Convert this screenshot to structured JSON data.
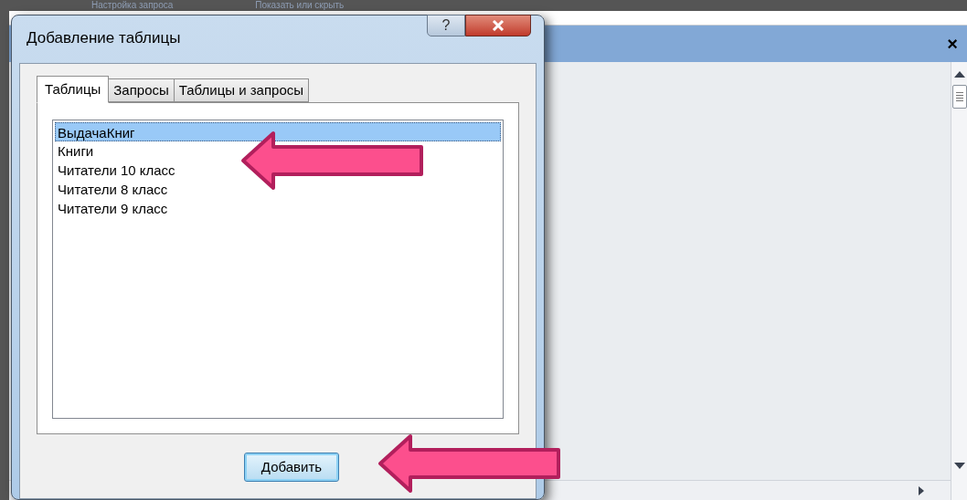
{
  "ribbon_groups": [
    "Настройка запроса",
    "Показать или скрыть"
  ],
  "pane": {
    "close": "×"
  },
  "dialog": {
    "title": "Добавление таблицы",
    "help": "?",
    "tabs": [
      {
        "label": "Таблицы",
        "selected": true
      },
      {
        "label": "Запросы",
        "selected": false
      },
      {
        "label": "Таблицы и запросы",
        "selected": false
      }
    ],
    "items": [
      {
        "label": "ВыдачаКниг",
        "selected": true
      },
      {
        "label": "Книги",
        "selected": false
      },
      {
        "label": "Читатели 10 класс",
        "selected": false
      },
      {
        "label": "Читатели 8 класс",
        "selected": false
      },
      {
        "label": "Читатели 9 класс",
        "selected": false
      }
    ],
    "add_button": "Добавить"
  }
}
